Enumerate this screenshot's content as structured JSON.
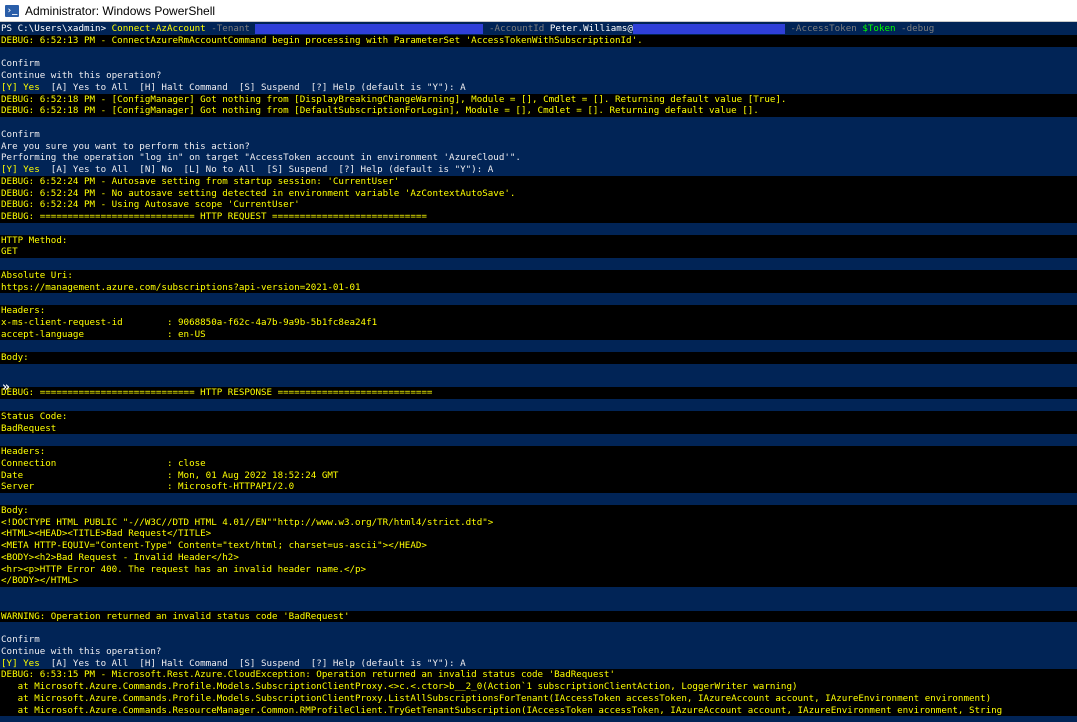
{
  "window": {
    "title": "Administrator: Windows PowerShell",
    "icon_glyph": "›_",
    "background": "#012456"
  },
  "prompt": {
    "path": "PS C:\\Users\\xadmin> ",
    "cmdlet": "Connect-AzAccount",
    "param_tenant": " -Tenant ",
    "param_account": " -AccountId ",
    "account_value": "Peter.Williams@",
    "param_token": " -AccessToken ",
    "token_var": "$Token",
    "param_debug": " -debug"
  },
  "lines": [
    {
      "text": "DEBUG: 6:52:13 PM - ConnectAzureRmAccountCommand begin processing with ParameterSet 'AccessTokenWithSubscriptionId'.",
      "style": "k"
    },
    {
      "text": "",
      "style": "b"
    },
    {
      "text": "Confirm",
      "style": "b"
    },
    {
      "text": "Continue with this operation?",
      "style": "b"
    },
    {
      "text": "[Y] Yes  [A] Yes to All  [H] Halt Command  [S] Suspend  [?] Help (default is \"Y\"): A",
      "style": "b",
      "prefix": "[Y] Yes",
      "prefix_color": "#ffff00"
    },
    {
      "text": "DEBUG: 6:52:18 PM - [ConfigManager] Got nothing from [DisplayBreakingChangeWarning], Module = [], Cmdlet = []. Returning default value [True].",
      "style": "k"
    },
    {
      "text": "DEBUG: 6:52:18 PM - [ConfigManager] Got nothing from [DefaultSubscriptionForLogin], Module = [], Cmdlet = []. Returning default value [].",
      "style": "k"
    },
    {
      "text": "",
      "style": "b"
    },
    {
      "text": "Confirm",
      "style": "b"
    },
    {
      "text": "Are you sure you want to perform this action?",
      "style": "b"
    },
    {
      "text": "Performing the operation \"log in\" on target \"AccessToken account in environment 'AzureCloud'\".",
      "style": "b"
    },
    {
      "text": "[Y] Yes  [A] Yes to All  [N] No  [L] No to All  [S] Suspend  [?] Help (default is \"Y\"): A",
      "style": "b",
      "prefix": "[Y] Yes",
      "prefix_color": "#ffff00"
    },
    {
      "text": "DEBUG: 6:52:24 PM - Autosave setting from startup session: 'CurrentUser'",
      "style": "k"
    },
    {
      "text": "DEBUG: 6:52:24 PM - No autosave setting detected in environment variable 'AzContextAutoSave'.",
      "style": "k"
    },
    {
      "text": "DEBUG: 6:52:24 PM - Using Autosave scope 'CurrentUser'",
      "style": "k"
    },
    {
      "text": "DEBUG: ============================ HTTP REQUEST ============================",
      "style": "k"
    },
    {
      "text": "",
      "style": "b"
    },
    {
      "text": "HTTP Method:",
      "style": "k"
    },
    {
      "text": "GET",
      "style": "k"
    },
    {
      "text": "",
      "style": "b"
    },
    {
      "text": "Absolute Uri:",
      "style": "k"
    },
    {
      "text": "https://management.azure.com/subscriptions?api-version=2021-01-01",
      "style": "k"
    },
    {
      "text": "",
      "style": "b"
    },
    {
      "text": "Headers:",
      "style": "k"
    },
    {
      "text": "x-ms-client-request-id        : 9068850a-f62c-4a7b-9a9b-5b1fc8ea24f1",
      "style": "k"
    },
    {
      "text": "accept-language               : en-US",
      "style": "k"
    },
    {
      "text": "",
      "style": "b"
    },
    {
      "text": "Body:",
      "style": "k"
    },
    {
      "text": "",
      "style": "b"
    },
    {
      "text": "",
      "style": "b"
    },
    {
      "text": "DEBUG: ============================ HTTP RESPONSE ============================",
      "style": "k"
    },
    {
      "text": "",
      "style": "b"
    },
    {
      "text": "Status Code:",
      "style": "k"
    },
    {
      "text": "BadRequest",
      "style": "k"
    },
    {
      "text": "",
      "style": "b"
    },
    {
      "text": "Headers:",
      "style": "k"
    },
    {
      "text": "Connection                    : close",
      "style": "k"
    },
    {
      "text": "Date                          : Mon, 01 Aug 2022 18:52:24 GMT",
      "style": "k"
    },
    {
      "text": "Server                        : Microsoft-HTTPAPI/2.0",
      "style": "k"
    },
    {
      "text": "",
      "style": "b"
    },
    {
      "text": "Body:",
      "style": "k"
    },
    {
      "text": "<!DOCTYPE HTML PUBLIC \"-//W3C//DTD HTML 4.01//EN\"\"http://www.w3.org/TR/html4/strict.dtd\">",
      "style": "k"
    },
    {
      "text": "<HTML><HEAD><TITLE>Bad Request</TITLE>",
      "style": "k"
    },
    {
      "text": "<META HTTP-EQUIV=\"Content-Type\" Content=\"text/html; charset=us-ascii\"></HEAD>",
      "style": "k"
    },
    {
      "text": "<BODY><h2>Bad Request - Invalid Header</h2>",
      "style": "k"
    },
    {
      "text": "<hr><p>HTTP Error 400. The request has an invalid header name.</p>",
      "style": "k"
    },
    {
      "text": "</BODY></HTML>",
      "style": "k"
    },
    {
      "text": "",
      "style": "b"
    },
    {
      "text": "",
      "style": "b"
    },
    {
      "text": "WARNING: Operation returned an invalid status code 'BadRequest'",
      "style": "k"
    },
    {
      "text": "",
      "style": "b"
    },
    {
      "text": "Confirm",
      "style": "b"
    },
    {
      "text": "Continue with this operation?",
      "style": "b"
    },
    {
      "text": "[Y] Yes  [A] Yes to All  [H] Halt Command  [S] Suspend  [?] Help (default is \"Y\"): A",
      "style": "b",
      "prefix": "[Y] Yes",
      "prefix_color": "#ffff00"
    },
    {
      "text": "DEBUG: 6:53:15 PM - Microsoft.Rest.Azure.CloudException: Operation returned an invalid status code 'BadRequest'",
      "style": "k"
    },
    {
      "text": "   at Microsoft.Azure.Commands.Profile.Models.SubscriptionClientProxy.<>c.<.ctor>b__2_0(Action`1 subscriptionClientAction, LoggerWriter warning)",
      "style": "k"
    },
    {
      "text": "   at Microsoft.Azure.Commands.Profile.Models.SubscriptionClientProxy.ListAllSubscriptionsForTenant(IAccessToken accessToken, IAzureAccount account, IAzureEnvironment environment)",
      "style": "k"
    },
    {
      "text": "   at Microsoft.Azure.Commands.ResourceManager.Common.RMProfileClient.TryGetTenantSubscription(IAccessToken accessToken, IAzureAccount account, IAzureEnvironment environment, String",
      "style": "k"
    }
  ],
  "cursor_glyph": "»"
}
